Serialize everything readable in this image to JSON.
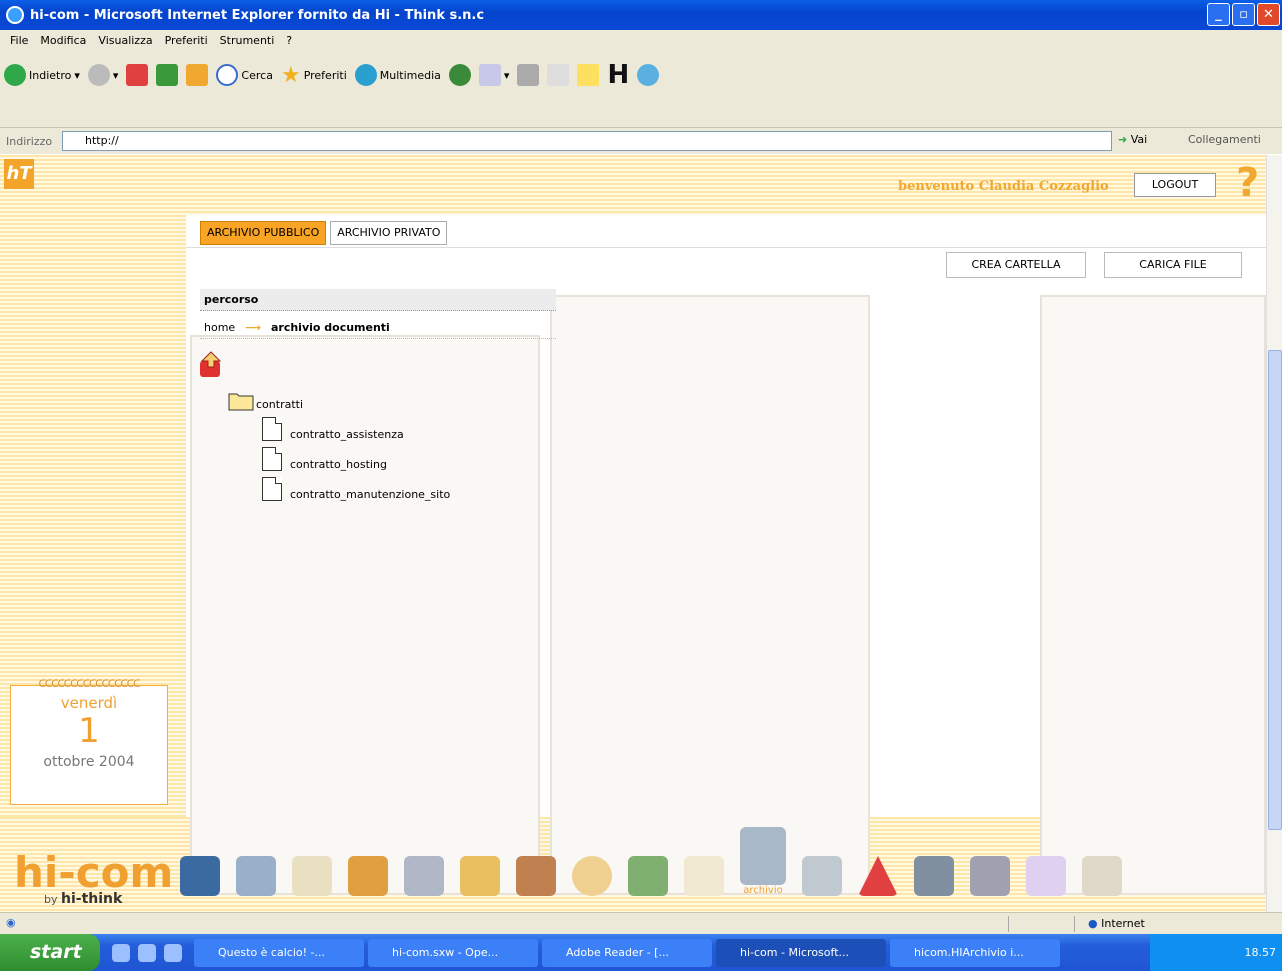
{
  "window": {
    "title": "hi-com - Microsoft Internet Explorer fornito da Hi - Think s.n.c"
  },
  "menu": [
    "File",
    "Modifica",
    "Visualizza",
    "Preferiti",
    "Strumenti",
    "?"
  ],
  "toolbar": {
    "back": "Indietro",
    "search": "Cerca",
    "favorites": "Preferiti",
    "media": "Multimedia"
  },
  "address": {
    "label": "Indirizzo",
    "value": "http://",
    "go": "Vai",
    "links": "Collegamenti"
  },
  "page": {
    "welcome": "benvenuto Claudia Cozzaglio",
    "logout": "LOGOUT",
    "tabs": [
      "ARCHIVIO PUBBLICO",
      "ARCHIVIO PRIVATO"
    ],
    "actions": {
      "create_folder": "CREA CARTELLA",
      "upload_file": "CARICA FILE"
    },
    "path_header": "percorso",
    "breadcrumb": {
      "home": "home",
      "current": "archivio documenti"
    },
    "folder": "contratti",
    "files": [
      "contratto_assistenza",
      "contratto_hosting",
      "contratto_manutenzione_sito"
    ],
    "calendar": {
      "weekday": "venerdì",
      "day": "1",
      "month_year": "ottobre 2004"
    },
    "brand": {
      "name": "hi-com",
      "by": "by",
      "company": "hi-think"
    },
    "dock_active_label": "archivio"
  },
  "status": {
    "zone": "Internet"
  },
  "taskbar": {
    "start": "start",
    "tasks": [
      "Questo è calcio! -...",
      "hi-com.sxw - Ope...",
      "Adobe Reader - [...",
      "hi-com - Microsoft...",
      "hicom.HIArchivio i..."
    ],
    "clock": "18.57"
  }
}
